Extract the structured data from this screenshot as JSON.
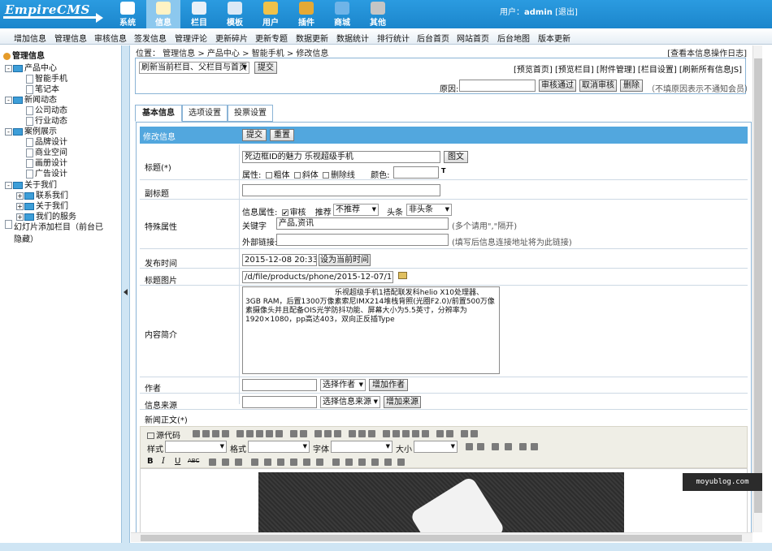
{
  "app": {
    "logo": "EmpireCMS"
  },
  "nav": [
    {
      "label": "系统",
      "icon": "system-icon",
      "color": "#ffffff"
    },
    {
      "label": "信息",
      "icon": "info-icon",
      "color": "#fff3c4",
      "active": true
    },
    {
      "label": "栏目",
      "icon": "column-icon",
      "color": "#e8f0f8"
    },
    {
      "label": "模板",
      "icon": "template-icon",
      "color": "#dbe9f6"
    },
    {
      "label": "用户",
      "icon": "user-icon",
      "color": "#f0c24a"
    },
    {
      "label": "插件",
      "icon": "plugin-icon",
      "color": "#e5a935"
    },
    {
      "label": "商城",
      "icon": "shop-icon",
      "color": "#6fb4e8"
    },
    {
      "label": "其他",
      "icon": "gear-icon",
      "color": "#c5c5c5"
    }
  ],
  "user": {
    "prefix": "用户：",
    "name": "admin",
    "logout": "[退出]"
  },
  "menu": [
    "增加信息",
    "管理信息",
    "审核信息",
    "签发信息",
    "管理评论",
    "更新碎片",
    "更新专题",
    "数据更新",
    "数据统计",
    "排行统计",
    "后台首页",
    "网站首页",
    "后台地图",
    "版本更新"
  ],
  "sidebar": {
    "title": "管理信息",
    "items": [
      {
        "label": "产品中心",
        "type": "folder",
        "expand": "-"
      },
      {
        "label": "智能手机",
        "type": "doc"
      },
      {
        "label": "笔记本",
        "type": "doc"
      },
      {
        "label": "新闻动态",
        "type": "folder",
        "expand": "-"
      },
      {
        "label": "公司动态",
        "type": "doc"
      },
      {
        "label": "行业动态",
        "type": "doc"
      },
      {
        "label": "案例展示",
        "type": "folder",
        "expand": "-"
      },
      {
        "label": "品牌设计",
        "type": "doc"
      },
      {
        "label": "商业空间",
        "type": "doc"
      },
      {
        "label": "画册设计",
        "type": "doc"
      },
      {
        "label": "广告设计",
        "type": "doc"
      },
      {
        "label": "关于我们",
        "type": "folder",
        "expand": "-"
      },
      {
        "label": "联系我们",
        "type": "folder",
        "expand": "+"
      },
      {
        "label": "关于我们",
        "type": "folder",
        "expand": "+"
      },
      {
        "label": "我们的服务",
        "type": "folder",
        "expand": "+"
      },
      {
        "label": "幻灯片添加栏目（前台已隐藏）",
        "type": "doc"
      }
    ]
  },
  "breadcrumb": "位置： 管理信息 > 产品中心 > 智能手机 > 修改信息",
  "log_link": "[查看本信息操作日志]",
  "refresh": {
    "select": "刷新当前栏目、父栏目与首页",
    "submit": "提交"
  },
  "preview_links": "[预览首页] [预览栏目] [附件管理] [栏目设置] [刷新所有信息JS]",
  "audit": {
    "reason_label": "原因:",
    "pass": "审核通过",
    "cancel": "取消审核",
    "delete": "删除",
    "hint": "（不填原因表示不通知会员）"
  },
  "tabs": [
    "基本信息",
    "选项设置",
    "投票设置"
  ],
  "form": {
    "header": "修改信息",
    "submit": "提交",
    "reset": "重置",
    "title_label": "标题(*)",
    "title_value": "死边框ID的魅力 乐视超级手机",
    "title_pic_btn": "图文",
    "attr_label": "属性:",
    "bold": "粗体",
    "italic": "斜体",
    "strike": "删除线",
    "color_label": "颜色:",
    "subtitle_label": "副标题",
    "special_label": "特殊属性",
    "info_attr": "信息属性:",
    "audit": "审核",
    "recommend": "推荐",
    "recommend_value": "不推荐",
    "headline": "头条",
    "headline_value": "非头条",
    "keyword_label": "关键字",
    "keyword_value": "产品,资讯",
    "keyword_hint": "(多个请用\",\"隔开)",
    "link_label": "外部链接:",
    "link_hint": "(填写后信息连接地址将为此链接)",
    "date_label": "发布时间",
    "date_value": "2015-12-08 20:33:22",
    "date_btn": "设为当前时间",
    "pic_label": "标题图片",
    "pic_value": "/d/file/products/phone/2015-12-07/1874fd1",
    "intro_label": "内容简介",
    "intro_value": "乐视超级手机1搭配联发科helio X10处理器、3GB RAM，后置1300万像素索尼IMX214堆栈背照(光圈F2.0)/前置500万像素摄像头并且配备OIS光学防抖功能、屏幕大小为5.5英寸，分辨率为1920×1080，pp高达403，双向正反插Type",
    "author_label": "作者",
    "author_select": "选择作者",
    "author_add": "增加作者",
    "source_label": "信息来源",
    "source_select": "选择信息来源",
    "source_add": "增加来源",
    "body_label": "新闻正文(*)"
  },
  "editor": {
    "source": "源代码",
    "style": "样式",
    "format": "格式",
    "font": "字体",
    "size": "大小"
  },
  "watermark": "moyublog.com"
}
